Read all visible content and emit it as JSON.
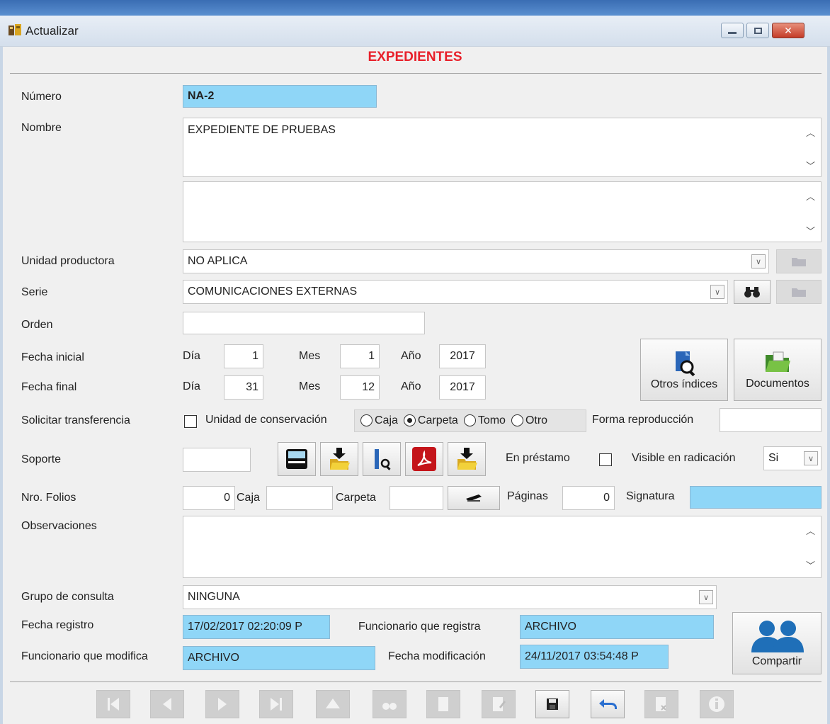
{
  "window": {
    "title": "Actualizar",
    "heading": "EXPEDIENTES"
  },
  "form": {
    "numero": {
      "label": "Número",
      "value": "NA-2"
    },
    "nombre": {
      "label": "Nombre",
      "value": "EXPEDIENTE DE PRUEBAS",
      "second_value": ""
    },
    "unidad_productora": {
      "label": "Unidad productora",
      "value": "NO APLICA"
    },
    "serie": {
      "label": "Serie",
      "value": "COMUNICACIONES EXTERNAS"
    },
    "orden": {
      "label": "Orden",
      "value": ""
    },
    "fecha_inicial": {
      "label": "Fecha inicial",
      "dia_label": "Día",
      "dia": "1",
      "mes_label": "Mes",
      "mes": "1",
      "anio_label": "Año",
      "anio": "2017"
    },
    "fecha_final": {
      "label": "Fecha final",
      "dia_label": "Día",
      "dia": "31",
      "mes_label": "Mes",
      "mes": "12",
      "anio_label": "Año",
      "anio": "2017"
    },
    "otros_indices_label": "Otros índices",
    "documentos_label": "Documentos",
    "solicitar_transferencia": {
      "label": "Solicitar transferencia",
      "checked": false
    },
    "unidad_conservacion": {
      "label": "Unidad de conservación",
      "options": [
        "Caja",
        "Carpeta",
        "Tomo",
        "Otro"
      ],
      "selected": "Carpeta"
    },
    "forma_reproduccion": {
      "label": "Forma reproducción",
      "value": ""
    },
    "soporte": {
      "label": "Soporte",
      "value": ""
    },
    "en_prestamo": {
      "label": "En préstamo",
      "checked": false
    },
    "visible_radicacion": {
      "label": "Visible en radicación",
      "value": "Si"
    },
    "nro_folios": {
      "label": "Nro. Folios",
      "value": "0"
    },
    "caja": {
      "label": "Caja",
      "value": ""
    },
    "carpeta": {
      "label": "Carpeta",
      "value": ""
    },
    "paginas": {
      "label": "Páginas",
      "value": "0"
    },
    "signatura": {
      "label": "Signatura",
      "value": ""
    },
    "observaciones": {
      "label": "Observaciones",
      "value": ""
    },
    "grupo_consulta": {
      "label": "Grupo de consulta",
      "value": "NINGUNA"
    },
    "fecha_registro": {
      "label": "Fecha registro",
      "value": "17/02/2017 02:20:09 P"
    },
    "funcionario_registra": {
      "label": "Funcionario que registra",
      "value": "ARCHIVO"
    },
    "funcionario_modifica": {
      "label": "Funcionario que modifica",
      "value": "ARCHIVO"
    },
    "fecha_modificacion": {
      "label": "Fecha modificación",
      "value": "24/11/2017 03:54:48 P"
    },
    "compartir_label": "Compartir"
  },
  "colors": {
    "heading": "#e8202a",
    "blue_field": "#8fd6f7",
    "share_icon": "#1f6fb8"
  }
}
